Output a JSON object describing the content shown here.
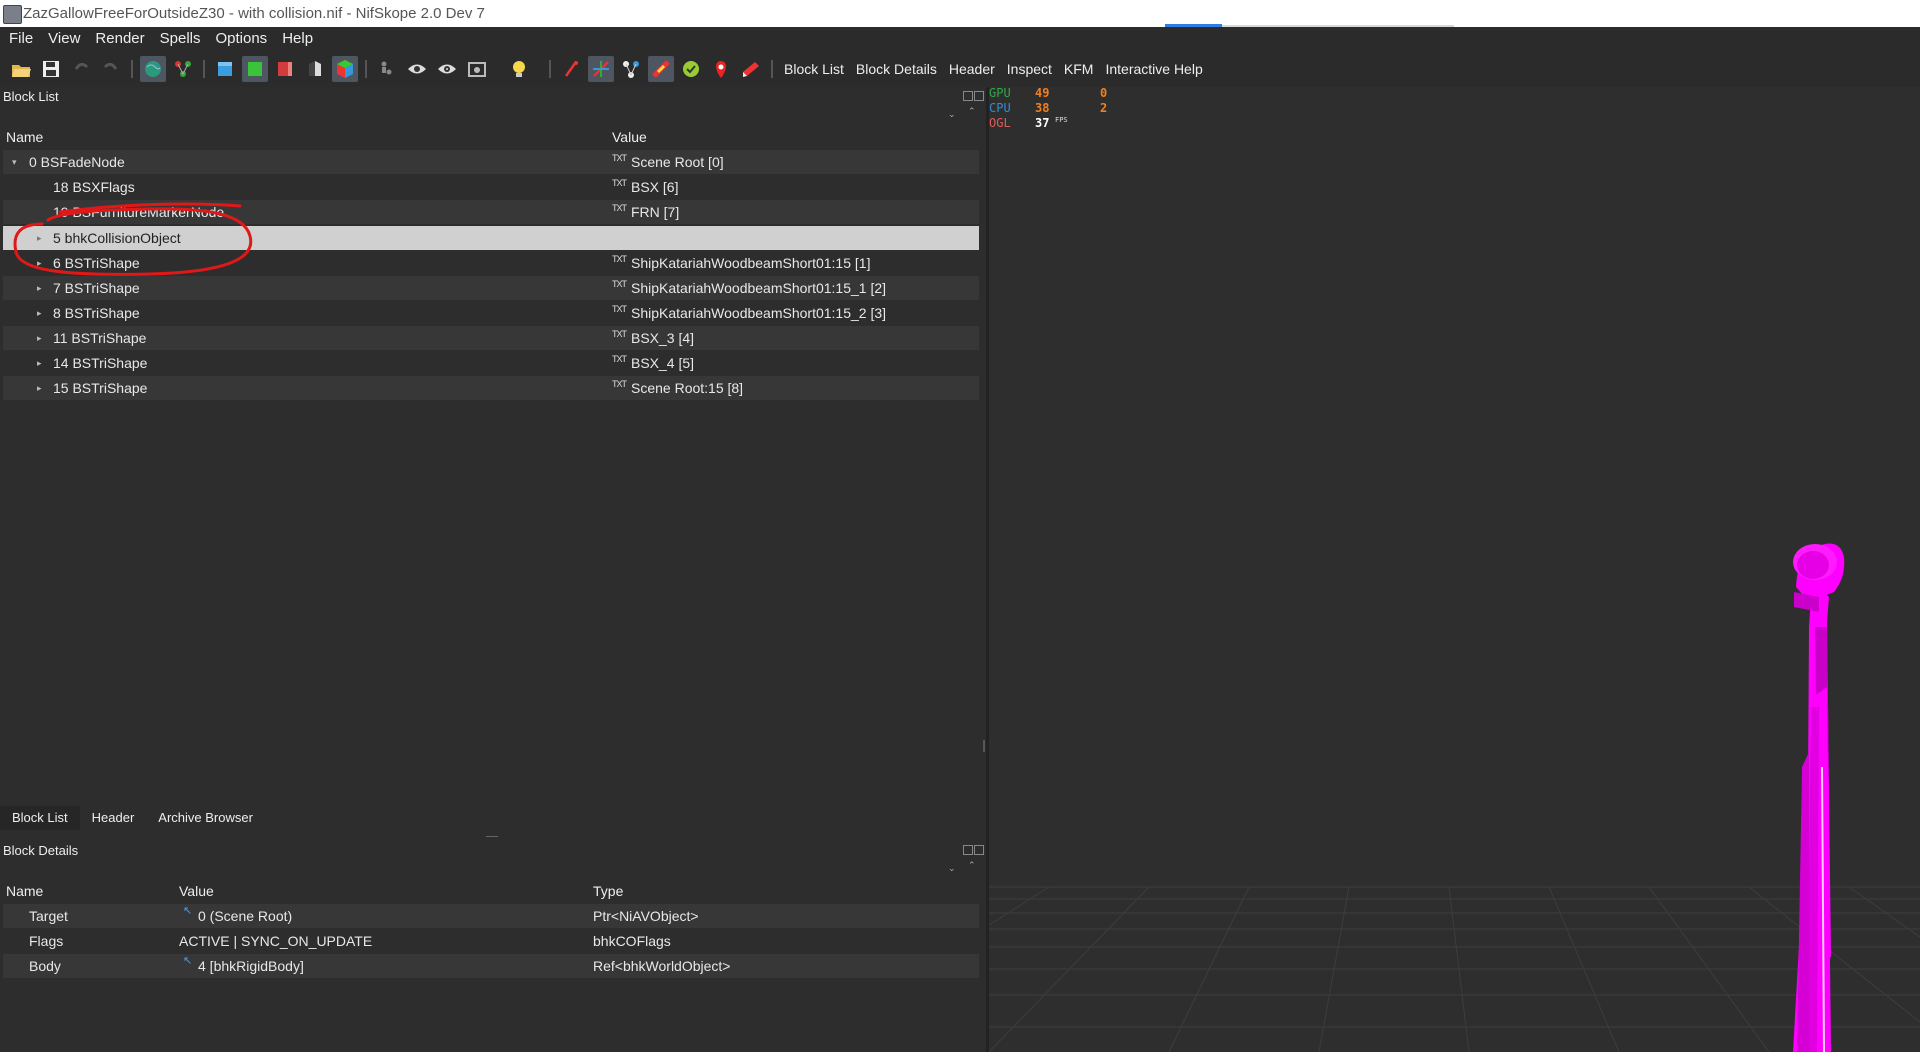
{
  "window": {
    "title": "ZazGallowFreeForOutsideZ30 - with collision.nif - NifSkope 2.0 Dev 7"
  },
  "menu": [
    "File",
    "View",
    "Render",
    "Spells",
    "Options",
    "Help"
  ],
  "toolbar": {
    "text_buttons": [
      "Block List",
      "Block Details",
      "Header",
      "Inspect",
      "KFM",
      "Interactive Help"
    ]
  },
  "block_list": {
    "title": "Block List",
    "columns": {
      "name": "Name",
      "value": "Value"
    },
    "rows": [
      {
        "name": "0 BSFadeNode",
        "value": "Scene Root [0]",
        "expander": "▾"
      },
      {
        "name": "18 BSXFlags",
        "value": "BSX [6]",
        "expander": ""
      },
      {
        "name": "19 BSFurnitureMarkerNode",
        "value": "FRN [7]",
        "expander": ""
      },
      {
        "name": "5 bhkCollisionObject",
        "value": "",
        "expander": "▸"
      },
      {
        "name": "6 BSTriShape",
        "value": "ShipKatariahWoodbeamShort01:15 [1]",
        "expander": "▸"
      },
      {
        "name": "7 BSTriShape",
        "value": "ShipKatariahWoodbeamShort01:15_1 [2]",
        "expander": "▸"
      },
      {
        "name": "8 BSTriShape",
        "value": "ShipKatariahWoodbeamShort01:15_2 [3]",
        "expander": "▸"
      },
      {
        "name": "11 BSTriShape",
        "value": "BSX_3 [4]",
        "expander": "▸"
      },
      {
        "name": "14 BSTriShape",
        "value": "BSX_4 [5]",
        "expander": "▸"
      },
      {
        "name": "15 BSTriShape",
        "value": "Scene Root:15 [8]",
        "expander": "▸"
      }
    ]
  },
  "bottom_tabs": [
    "Block List",
    "Header",
    "Archive Browser"
  ],
  "block_details": {
    "title": "Block Details",
    "columns": {
      "name": "Name",
      "value": "Value",
      "type": "Type"
    },
    "rows": [
      {
        "name": "Target",
        "value": "0 (Scene Root)",
        "type": "Ptr<NiAVObject>"
      },
      {
        "name": "Flags",
        "value": "ACTIVE | SYNC_ON_UPDATE",
        "type": "bhkCOFlags"
      },
      {
        "name": "Body",
        "value": "4 [bhkRigidBody]",
        "type": "Ref<bhkWorldObject>"
      }
    ]
  },
  "fps_overlay": {
    "rows": [
      {
        "label": "GPU",
        "v1": "49",
        "v2": "0",
        "color": "#2ea84a"
      },
      {
        "label": "CPU",
        "v1": "38",
        "v2": "2",
        "color": "#2a8fd6"
      },
      {
        "label": "OGL",
        "v1": "37",
        "v2": "",
        "color": "#e05a5a"
      }
    ],
    "fps_unit": "FPS"
  },
  "colors": {
    "model": "#ff00ff",
    "selection": "#d0d0d0",
    "annotation": "#e01818"
  }
}
